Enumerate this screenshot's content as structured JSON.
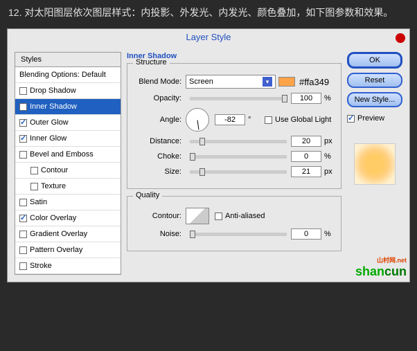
{
  "instruction": "12. 对太阳图层依次图层样式：内投影、外发光、内发光、颜色叠加，如下图参数和效果。",
  "dialog": {
    "title": "Layer Style"
  },
  "styles": {
    "header": "Styles",
    "items": [
      {
        "label": "Blending Options: Default",
        "checked": null
      },
      {
        "label": "Drop Shadow",
        "checked": false
      },
      {
        "label": "Inner Shadow",
        "checked": true,
        "selected": true
      },
      {
        "label": "Outer Glow",
        "checked": true
      },
      {
        "label": "Inner Glow",
        "checked": true
      },
      {
        "label": "Bevel and Emboss",
        "checked": false
      },
      {
        "label": "Contour",
        "checked": false,
        "sub": true
      },
      {
        "label": "Texture",
        "checked": false,
        "sub": true
      },
      {
        "label": "Satin",
        "checked": false
      },
      {
        "label": "Color Overlay",
        "checked": true
      },
      {
        "label": "Gradient Overlay",
        "checked": false
      },
      {
        "label": "Pattern Overlay",
        "checked": false
      },
      {
        "label": "Stroke",
        "checked": false
      }
    ]
  },
  "center": {
    "title": "Inner Shadow",
    "structure": {
      "label": "Structure",
      "blendMode": {
        "label": "Blend Mode:",
        "value": "Screen"
      },
      "color": "#ffa349",
      "opacity": {
        "label": "Opacity:",
        "value": "100",
        "unit": "%"
      },
      "angle": {
        "label": "Angle:",
        "value": "-82",
        "unit": "°",
        "global": "Use Global Light",
        "globalChecked": false
      },
      "distance": {
        "label": "Distance:",
        "value": "20",
        "unit": "px"
      },
      "choke": {
        "label": "Choke:",
        "value": "0",
        "unit": "%"
      },
      "size": {
        "label": "Size:",
        "value": "21",
        "unit": "px"
      }
    },
    "quality": {
      "label": "Quality",
      "contour": {
        "label": "Contour:"
      },
      "antialiased": {
        "label": "Anti-aliased",
        "checked": false
      },
      "noise": {
        "label": "Noise:",
        "value": "0",
        "unit": "%"
      }
    }
  },
  "right": {
    "ok": "OK",
    "reset": "Reset",
    "newStyle": "New Style...",
    "preview": {
      "label": "Preview",
      "checked": true
    }
  },
  "watermark": {
    "line1": "shan",
    "line2": "cun",
    "sub": "山村网.net"
  }
}
